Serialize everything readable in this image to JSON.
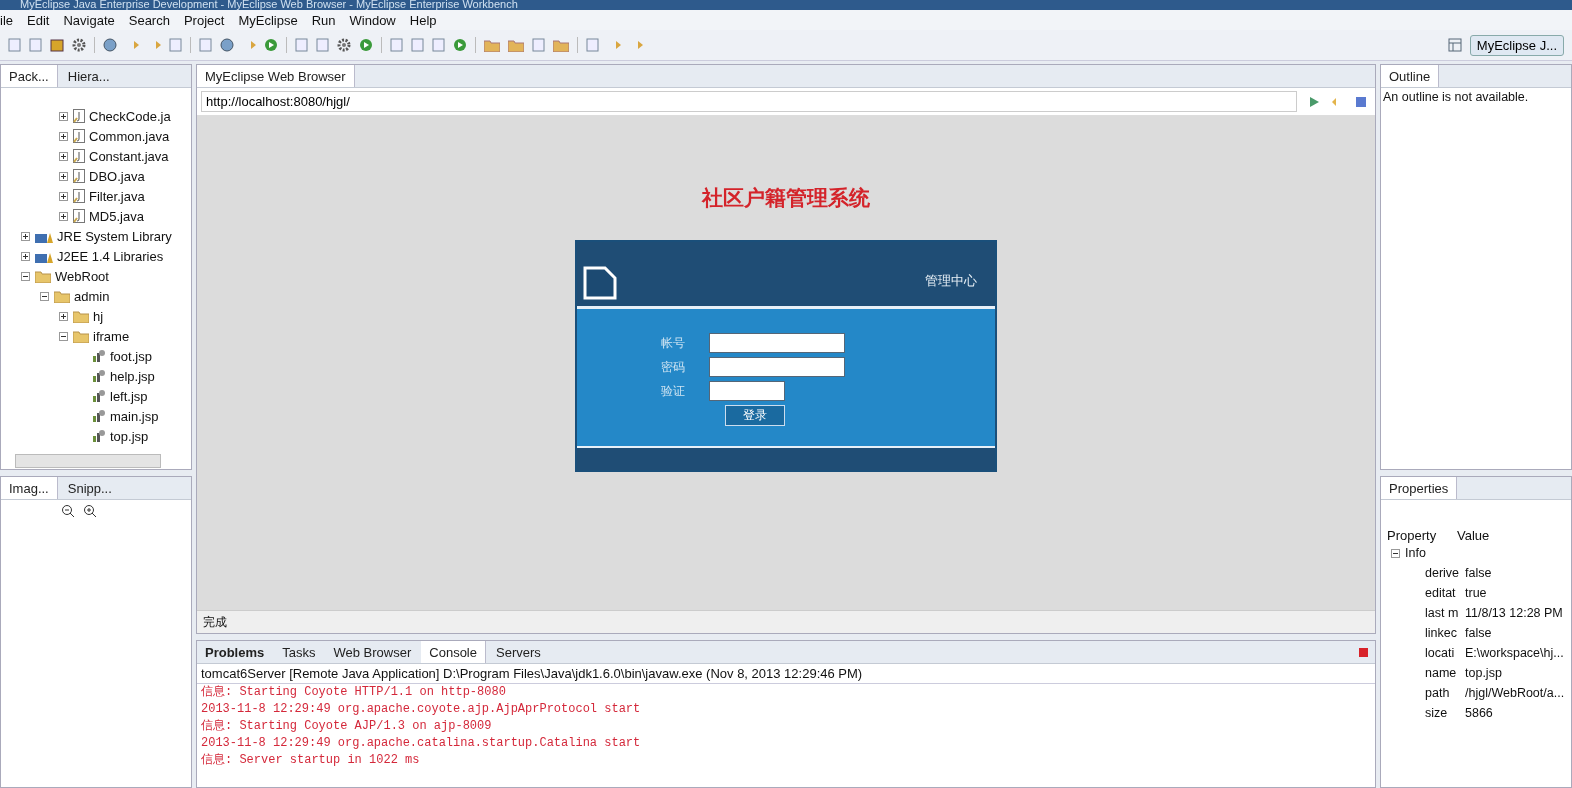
{
  "window": {
    "title": "MyEclipse Java Enterprise Development - MyEclipse Web Browser - MyEclipse Enterprise Workbench"
  },
  "menu": [
    "ile",
    "Edit",
    "Navigate",
    "Search",
    "Project",
    "MyEclipse",
    "Run",
    "Window",
    "Help"
  ],
  "perspective": {
    "label": "MyEclipse J..."
  },
  "left_top": {
    "tabs": [
      {
        "label": "Pack...",
        "selected": true
      },
      {
        "label": "Hiera...",
        "selected": false
      }
    ],
    "tree": [
      {
        "children": [
          {
            "children": [
              {
                "label": "CheckCode.ja",
                "kind": "java",
                "expanded": false
              },
              {
                "label": "Common.java",
                "kind": "java",
                "expanded": false
              },
              {
                "label": "Constant.java",
                "kind": "java",
                "expanded": false
              },
              {
                "label": "DBO.java",
                "kind": "java",
                "expanded": false
              },
              {
                "label": "Filter.java",
                "kind": "java",
                "expanded": false
              },
              {
                "label": "MD5.java",
                "kind": "java",
                "expanded": false
              }
            ]
          }
        ]
      },
      {
        "label": "JRE System Library",
        "kind": "library",
        "expanded": false
      },
      {
        "label": "J2EE 1.4 Libraries",
        "kind": "library",
        "expanded": false
      },
      {
        "label": "WebRoot",
        "kind": "folder",
        "expanded": true,
        "children": [
          {
            "label": "admin",
            "kind": "folder",
            "expanded": true,
            "children": [
              {
                "label": "hj",
                "kind": "folder",
                "expanded": false
              },
              {
                "label": "iframe",
                "kind": "folder",
                "expanded": true,
                "children": [
                  {
                    "label": "foot.jsp",
                    "kind": "jsp"
                  },
                  {
                    "label": "help.jsp",
                    "kind": "jsp"
                  },
                  {
                    "label": "left.jsp",
                    "kind": "jsp"
                  },
                  {
                    "label": "main.jsp",
                    "kind": "jsp"
                  },
                  {
                    "label": "top.jsp",
                    "kind": "jsp"
                  }
                ]
              }
            ]
          }
        ]
      }
    ]
  },
  "left_bottom": {
    "tabs": [
      {
        "label": "Imag...",
        "selected": true
      },
      {
        "label": "Snipp...",
        "selected": false
      }
    ]
  },
  "editor": {
    "tabs": [
      {
        "label": "MyEclipse Web Browser",
        "selected": true
      }
    ],
    "address": "http://localhost:8080/hjgl/",
    "page": {
      "title": "社区户籍管理系统",
      "panel_title": "管理中心",
      "fields": [
        {
          "label": "帐号"
        },
        {
          "label": "密码"
        },
        {
          "label": "验证"
        }
      ],
      "button": "登录"
    },
    "status": "完成"
  },
  "console": {
    "tabs": [
      {
        "label": "Problems",
        "selected": false,
        "bold": true
      },
      {
        "label": "Tasks",
        "selected": false,
        "bold": false
      },
      {
        "label": "Web Browser",
        "selected": false,
        "bold": false
      },
      {
        "label": "Console",
        "selected": true,
        "bold": false
      },
      {
        "label": "Servers",
        "selected": false,
        "bold": false
      }
    ],
    "header": "tomcat6Server [Remote Java Application] D:\\Program Files\\Java\\jdk1.6.0\\bin\\javaw.exe (Nov 8, 2013 12:29:46 PM)",
    "lines": [
      "信息: Starting Coyote HTTP/1.1 on http-8080",
      "2013-11-8 12:29:49 org.apache.coyote.ajp.AjpAprProtocol start",
      "信息: Starting Coyote AJP/1.3 on ajp-8009",
      "2013-11-8 12:29:49 org.apache.catalina.startup.Catalina start",
      "信息: Server startup in 1022 ms"
    ]
  },
  "outline": {
    "tabs": [
      {
        "label": "Outline",
        "selected": true
      }
    ],
    "message": "An outline is not available."
  },
  "properties": {
    "tabs": [
      {
        "label": "Properties",
        "selected": true
      }
    ],
    "columns": [
      "Property",
      "Value"
    ],
    "group": {
      "label": "Info",
      "expanded": true
    },
    "rows": [
      {
        "name": "derive",
        "value": "false"
      },
      {
        "name": "editat",
        "value": "true"
      },
      {
        "name": "last m",
        "value": "11/8/13 12:28 PM"
      },
      {
        "name": "linkec",
        "value": "false"
      },
      {
        "name": "locati",
        "value": "E:\\workspace\\hj..."
      },
      {
        "name": "name",
        "value": "top.jsp"
      },
      {
        "name": "path",
        "value": "/hjgl/WebRoot/a..."
      },
      {
        "name": "size",
        "value": "5866"
      }
    ]
  }
}
